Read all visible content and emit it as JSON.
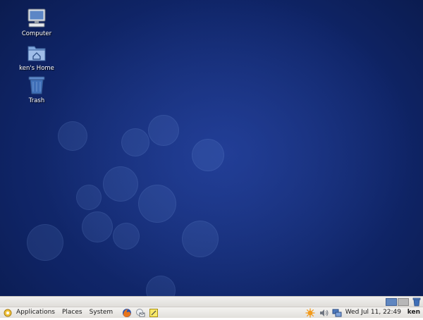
{
  "desktop": {
    "icons": [
      {
        "label": "Computer",
        "icon": "computer-icon"
      },
      {
        "label": "ken's Home",
        "icon": "home-folder-icon"
      },
      {
        "label": "Trash",
        "icon": "trash-icon"
      }
    ]
  },
  "panel": {
    "menus": [
      "Applications",
      "Places",
      "System"
    ],
    "launchers": [
      "firefox-icon",
      "mail-icon",
      "notes-icon"
    ],
    "tray_icons": [
      "update-notifier-icon",
      "volume-icon",
      "network-icon"
    ],
    "clock": "Wed Jul 11, 22:49",
    "user": "ken"
  },
  "workspaces": {
    "count": 2,
    "active_index": 0
  },
  "colors": {
    "desktop_bg": "#0f2466",
    "panel_bg": "#e8e6e2",
    "workspace_active": "#5f86c0"
  }
}
